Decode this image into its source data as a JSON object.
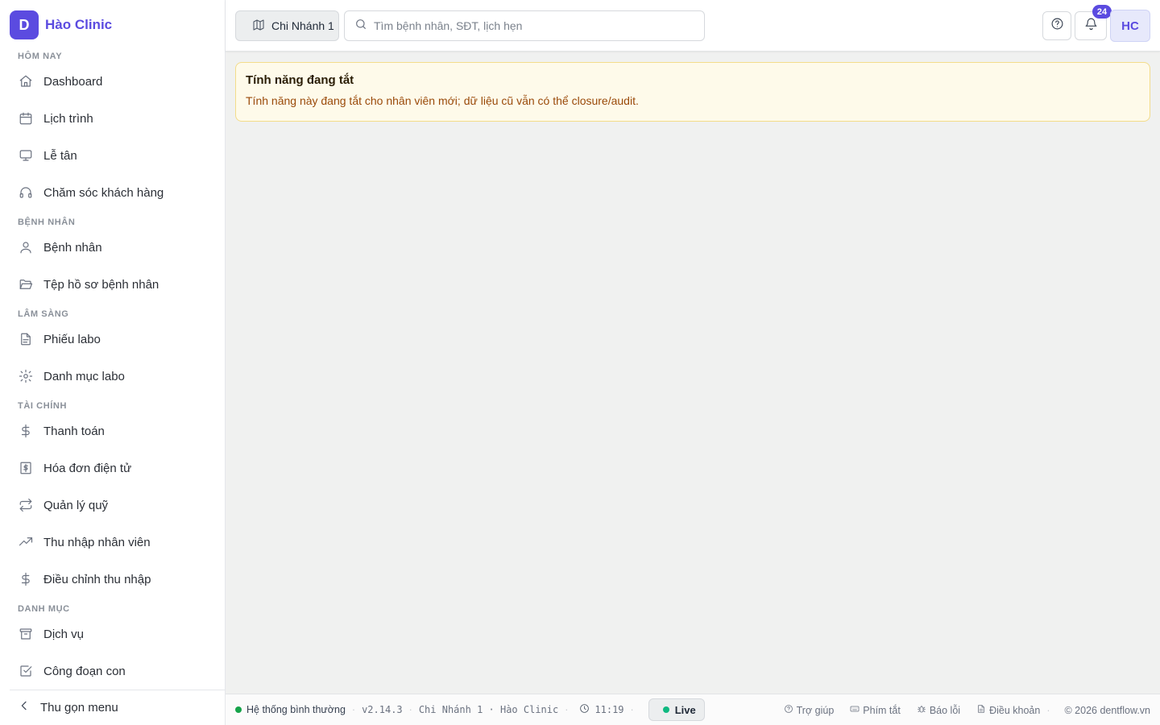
{
  "brand": {
    "logo_letter": "D",
    "name": "Hào Clinic",
    "accent_color": "#5b4be0"
  },
  "sidebar": {
    "sections": [
      {
        "label": "HÔM NAY",
        "items": [
          {
            "label": "Dashboard",
            "icon": "home-icon"
          },
          {
            "label": "Lịch trình",
            "icon": "calendar-icon"
          },
          {
            "label": "Lễ tân",
            "icon": "monitor-icon"
          },
          {
            "label": "Chăm sóc khách hàng",
            "icon": "headphones-icon"
          }
        ]
      },
      {
        "label": "BỆNH NHÂN",
        "items": [
          {
            "label": "Bệnh nhân",
            "icon": "user-icon"
          },
          {
            "label": "Tệp hồ sơ bệnh nhân",
            "icon": "folder-open-icon"
          }
        ]
      },
      {
        "label": "LÂM SÀNG",
        "items": [
          {
            "label": "Phiếu labo",
            "icon": "file-text-icon"
          },
          {
            "label": "Danh mục labo",
            "icon": "gear-icon"
          }
        ]
      },
      {
        "label": "TÀI CHÍNH",
        "items": [
          {
            "label": "Thanh toán",
            "icon": "dollar-icon"
          },
          {
            "label": "Hóa đơn điện tử",
            "icon": "receipt-icon"
          },
          {
            "label": "Quản lý quỹ",
            "icon": "repeat-icon"
          },
          {
            "label": "Thu nhập nhân viên",
            "icon": "trending-up-icon"
          },
          {
            "label": "Điều chỉnh thu nhập",
            "icon": "dollar-icon"
          }
        ]
      },
      {
        "label": "DANH MỤC",
        "items": [
          {
            "label": "Dịch vụ",
            "icon": "archive-icon"
          },
          {
            "label": "Công đoạn con",
            "icon": "check-square-icon"
          }
        ]
      }
    ],
    "collapse_label": "Thu gọn menu"
  },
  "topbar": {
    "branch_label": "Chi Nhánh 1",
    "search_placeholder": "Tìm bệnh nhân, SĐT, lịch hẹn",
    "notification_count": "24",
    "avatar_initials": "HC"
  },
  "alert": {
    "title": "Tính năng đang tắt",
    "message": "Tính năng này đang tắt cho nhân viên mới; dữ liệu cũ vẫn có thể closure/audit."
  },
  "footer": {
    "status": "Hệ thống bình thường",
    "version": "v2.14.3",
    "location": "Chi Nhánh 1 · Hào Clinic",
    "time": "11:19",
    "live_label": "Live",
    "links": [
      {
        "label": "Trợ giúp",
        "icon": "help-circle-icon"
      },
      {
        "label": "Phím tắt",
        "icon": "keyboard-icon"
      },
      {
        "label": "Báo lỗi",
        "icon": "bug-icon"
      },
      {
        "label": "Điều khoản",
        "icon": "file-icon"
      }
    ],
    "copyright": "© 2026 dentflow.vn"
  }
}
